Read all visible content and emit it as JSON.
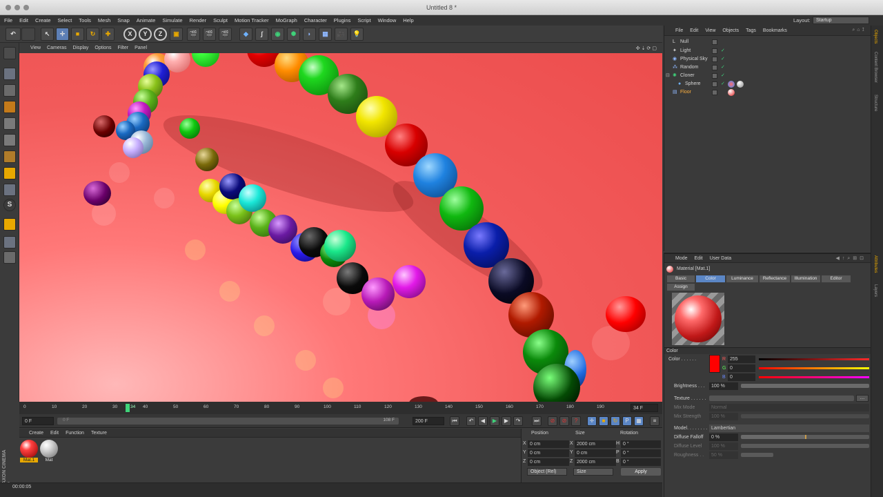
{
  "window": {
    "title": "Untitled 8 *"
  },
  "menu": [
    "File",
    "Edit",
    "Create",
    "Select",
    "Tools",
    "Mesh",
    "Snap",
    "Animate",
    "Simulate",
    "Render",
    "Sculpt",
    "Motion Tracker",
    "MoGraph",
    "Character",
    "Plugins",
    "Script",
    "Window",
    "Help"
  ],
  "layout": {
    "label": "Layout:",
    "value": "Startup"
  },
  "viewport_menu": [
    "View",
    "Cameras",
    "Display",
    "Options",
    "Filter",
    "Panel"
  ],
  "toolbar": {
    "axis_x": "X",
    "axis_y": "Y",
    "axis_z": "Z"
  },
  "timeline": {
    "ticks": [
      "0",
      "10",
      "20",
      "30",
      "40",
      "50",
      "60",
      "70",
      "80",
      "90",
      "100",
      "110",
      "120",
      "130",
      "140",
      "150",
      "160",
      "170",
      "180",
      "190"
    ],
    "current_frame": "34",
    "end_frame_display": "34 F",
    "start_field": "0 F",
    "range_start": "0 F",
    "range_end": "108 F",
    "end_field": "200 F"
  },
  "material_manager": {
    "menu": [
      "Create",
      "Edit",
      "Function",
      "Texture"
    ],
    "materials": [
      {
        "name": "Mat.1"
      },
      {
        "name": "Mat"
      }
    ]
  },
  "coordinates": {
    "headers": {
      "position": "Position",
      "size": "Size",
      "rotation": "Rotation"
    },
    "rows": [
      {
        "axis": "X",
        "pos": "0 cm",
        "saxis": "X",
        "size": "2000 cm",
        "raxis": "H",
        "rot": "0 °"
      },
      {
        "axis": "Y",
        "pos": "0 cm",
        "saxis": "Y",
        "size": "0 cm",
        "raxis": "P",
        "rot": "0 °"
      },
      {
        "axis": "Z",
        "pos": "0 cm",
        "saxis": "Z",
        "size": "2000 cm",
        "raxis": "B",
        "rot": "0 °"
      }
    ],
    "mode_select": "Object (Rel)",
    "size_select": "Size",
    "apply": "Apply"
  },
  "status": {
    "time": "00:00:05"
  },
  "object_manager": {
    "menu": [
      "File",
      "Edit",
      "View",
      "Objects",
      "Tags",
      "Bookmarks"
    ],
    "objects": [
      {
        "name": "Null"
      },
      {
        "name": "Light"
      },
      {
        "name": "Physical Sky"
      },
      {
        "name": "Random"
      },
      {
        "name": "Cloner"
      },
      {
        "name": "Sphere"
      },
      {
        "name": "Floor"
      }
    ]
  },
  "attributes": {
    "menu": [
      "Mode",
      "Edit",
      "User Data"
    ],
    "title": "Material [Mat.1]",
    "tabs": [
      "Basic",
      "Color",
      "Luminance",
      "Reflectance",
      "Illumination",
      "Editor",
      "Assign"
    ],
    "section": "Color",
    "color_label": "Color . . . . . .",
    "rgb": [
      {
        "ch": "R",
        "val": "255"
      },
      {
        "ch": "G",
        "val": "0"
      },
      {
        "ch": "B",
        "val": "0"
      }
    ],
    "brightness_label": "Brightness . . .",
    "brightness": "100 %",
    "texture_label": "Texture . . . . . .",
    "mix_mode_label": "Mix Mode",
    "mix_mode": "Normal",
    "mix_strength_label": "Mix Strength",
    "mix_strength": "100 %",
    "model_label": "Model. . . . . . . .",
    "model": "Lambertian",
    "diffuse_falloff_label": "Diffuse Falloff",
    "diffuse_falloff": "0 %",
    "diffuse_level_label": "Diffuse Level",
    "diffuse_level": "100 %",
    "roughness_label": "Roughness . .",
    "roughness": "50 %",
    "color_swatch": "#ff0000"
  },
  "right_tabs": [
    "Objects",
    "Content Browser",
    "Structure",
    "Attributes",
    "Layers"
  ],
  "brand": {
    "logo": "MAXON CINEMA 4D"
  },
  "colors": {
    "accent": "#5b86c5",
    "viewport_bg": "#ef5555",
    "playhead": "#3fd37a"
  }
}
